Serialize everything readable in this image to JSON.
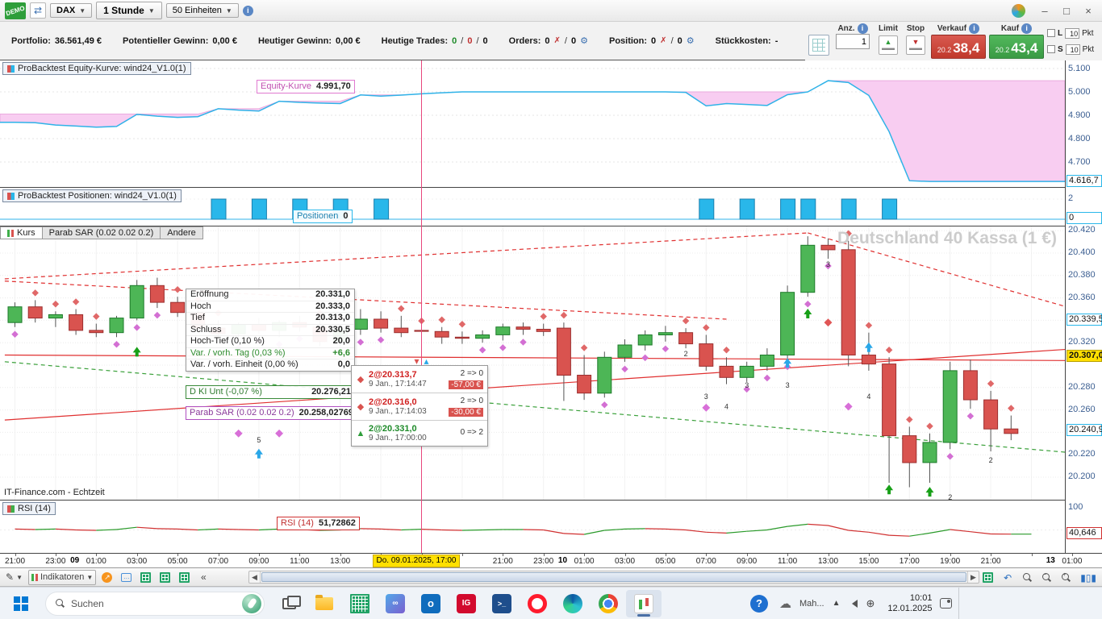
{
  "window": {
    "demo_badge": "DEMO",
    "instrument": "DAX",
    "timeframe": "1 Stunde",
    "units": "50 Einheiten"
  },
  "order_panel": {
    "anz_label": "Anz.",
    "anz_value": "1",
    "limit_label": "Limit",
    "stop_label": "Stop",
    "sell_label": "Verkauf",
    "sell_price_prefix": "20.2",
    "sell_price": "38,4",
    "buy_label": "Kauf",
    "buy_price_prefix": "20.2",
    "buy_price": "43,4",
    "long_label": "L",
    "short_label": "S",
    "long_pkt_value": "10",
    "short_pkt_value": "10",
    "pkt_label": "Pkt"
  },
  "stats": [
    {
      "label": "Portfolio:",
      "value": "36.561,49 €"
    },
    {
      "label": "Potentieller Gewinn:",
      "value": "0,00 €"
    },
    {
      "label": "Heutiger Gewinn:",
      "value": "0,00 €"
    },
    {
      "label": "Heutige Trades:",
      "v1": "0",
      "v2": "0",
      "v3": "0"
    },
    {
      "label": "Orders:",
      "v1": "0",
      "v2": "0"
    },
    {
      "label": "Position:",
      "v1": "0",
      "v2": "0"
    },
    {
      "label": "Stückkosten:",
      "value": "-"
    }
  ],
  "panels": {
    "equity_title": "ProBacktest Equity-Kurve: wind24_V1.0(1)",
    "equity_label": "Equity-Kurve",
    "equity_value": "4.991,70",
    "positions_title": "ProBacktest Positionen: wind24_V1.0(1)",
    "positions_label": "Positionen",
    "positions_value": "0",
    "rsi_title": "RSI (14)",
    "rsi_label": "RSI (14)",
    "rsi_value": "51,72862"
  },
  "main_chart": {
    "tabs": [
      "Kurs",
      "Parab SAR (0.02 0.02 0.2)",
      "Andere"
    ],
    "watermark": "Deutschland 40 Kassa (1 €)",
    "footer": "IT-Finance.com - Echtzeit",
    "tooltip": {
      "rows": [
        {
          "label": "Eröffnung",
          "value": "20.331,0"
        },
        {
          "label": "Hoch",
          "value": "20.333,0"
        },
        {
          "label": "Tief",
          "value": "20.313,0"
        },
        {
          "label": "Schluss",
          "value": "20.330,5"
        },
        {
          "label": "Hoch-Tief (0,10 %)",
          "value": "20,0"
        },
        {
          "label": "Var. / vorh. Tag (0,03 %)",
          "value": "+6,6"
        },
        {
          "label": "Var. / vorh. Einheit (0,00 %)",
          "value": "0,0"
        }
      ]
    },
    "dki": {
      "label": "D KI Unt (-0,07 %)",
      "value": "20.276,21"
    },
    "sar": {
      "label": "Parab SAR (0.02 0.02 0.2)",
      "value": "20.258,02769"
    },
    "trades": [
      {
        "qty": "2@20.313,7",
        "time": "9 Jan., 17:14:47",
        "transition": "2 => 0",
        "pnl": "-57,00 €"
      },
      {
        "qty": "2@20.316,0",
        "time": "9 Jan., 17:14:03",
        "transition": "2 => 0",
        "pnl": "-30,00 €"
      },
      {
        "qty": "2@20.331,0",
        "time": "9 Jan., 17:00:00",
        "transition": "0 => 2",
        "pnl": ""
      }
    ]
  },
  "axes": {
    "equity_ticks": [
      {
        "v": 5100,
        "label": "5.100"
      },
      {
        "v": 5000,
        "label": "5.000"
      },
      {
        "v": 4900,
        "label": "4.900"
      },
      {
        "v": 4800,
        "label": "4.800"
      },
      {
        "v": 4700,
        "label": "4.700"
      }
    ],
    "equity_current": {
      "v": 4616.7,
      "label": "4.616,7"
    },
    "positions_ticks": [
      {
        "level": 2,
        "label": "2"
      },
      {
        "level": 0,
        "label": "0"
      }
    ],
    "positions_current": {
      "label": "0"
    },
    "price_ticks": [
      {
        "v": 20420,
        "label": "20.420"
      },
      {
        "v": 20400,
        "label": "20.400"
      },
      {
        "v": 20380,
        "label": "20.380"
      },
      {
        "v": 20360,
        "label": "20.360"
      },
      {
        "v": 20320,
        "label": "20.320"
      },
      {
        "v": 20280,
        "label": "20.280"
      },
      {
        "v": 20260,
        "label": "20.260"
      },
      {
        "v": 20220,
        "label": "20.220"
      },
      {
        "v": 20200,
        "label": "20.200"
      }
    ],
    "price_current": [
      {
        "v": 20339.5,
        "label": "20.339,5",
        "style": "cyan"
      },
      {
        "v": 20307,
        "label": "20.307,0",
        "style": "yellow"
      },
      {
        "v": 20240.9,
        "label": "20.240,9",
        "style": "cyan"
      }
    ],
    "rsi_ticks": [
      {
        "v": 100,
        "label": "100"
      }
    ],
    "rsi_current": {
      "v": 40.646,
      "label": "40,646"
    }
  },
  "time_axis": {
    "hours": [
      {
        "i": 0,
        "t": "21:00"
      },
      {
        "i": 2,
        "t": "23:00"
      },
      {
        "i": 4,
        "t": "01:00"
      },
      {
        "i": 6,
        "t": "03:00"
      },
      {
        "i": 8,
        "t": "05:00"
      },
      {
        "i": 10,
        "t": "07:00"
      },
      {
        "i": 12,
        "t": "09:00"
      },
      {
        "i": 14,
        "t": "11:00"
      },
      {
        "i": 16,
        "t": "13:00"
      },
      {
        "i": 24,
        "t": "21:00"
      },
      {
        "i": 26,
        "t": "23:00"
      },
      {
        "i": 28,
        "t": "01:00"
      },
      {
        "i": 30,
        "t": "03:00"
      },
      {
        "i": 32,
        "t": "05:00"
      },
      {
        "i": 34,
        "t": "07:00"
      },
      {
        "i": 36,
        "t": "09:00"
      },
      {
        "i": 38,
        "t": "11:00"
      },
      {
        "i": 40,
        "t": "13:00"
      },
      {
        "i": 42,
        "t": "15:00"
      },
      {
        "i": 44,
        "t": "17:00"
      },
      {
        "i": 46,
        "t": "19:00"
      },
      {
        "i": 48,
        "t": "21:00"
      },
      {
        "i": 52,
        "t": "01:00"
      }
    ],
    "days": [
      {
        "i": 3,
        "t": "09"
      },
      {
        "i": 27,
        "t": "10"
      },
      {
        "i": 51,
        "t": "13"
      }
    ],
    "cursor": {
      "i": 20,
      "t": "Do. 09.01.2025, 17:00"
    }
  },
  "toolbar": {
    "indicators_label": "Indikatoren"
  },
  "taskbar": {
    "search_placeholder": "Suchen",
    "ig_label": "IG",
    "onedrive_text": "Mah...",
    "time": "10:01",
    "date": "12.01.2025"
  },
  "chart_data": {
    "type": "candlestick",
    "instrument": "DAX",
    "timeframe": "1 Stunde",
    "price_range": [
      20180,
      20424
    ],
    "candles": [
      [
        20338,
        20356,
        20334,
        20352
      ],
      [
        20352,
        20358,
        20338,
        20342
      ],
      [
        20342,
        20348,
        20334,
        20345
      ],
      [
        20345,
        20350,
        20327,
        20331
      ],
      [
        20331,
        20337,
        20325,
        20329
      ],
      [
        20329,
        20344,
        20325,
        20342
      ],
      [
        20342,
        20376,
        20340,
        20371
      ],
      [
        20371,
        20378,
        20351,
        20356
      ],
      [
        20356,
        20361,
        20343,
        20347
      ],
      [
        20347,
        20352,
        20329,
        20333
      ],
      [
        20333,
        20340,
        20323,
        20328
      ],
      [
        20328,
        20338,
        20322,
        20336
      ],
      [
        20336,
        20342,
        20328,
        20331
      ],
      [
        20331,
        20340,
        20325,
        20338
      ],
      [
        20338,
        20344,
        20330,
        20334
      ],
      [
        20334,
        20340,
        20317,
        20321
      ],
      [
        20321,
        20336,
        20315,
        20332
      ],
      [
        20332,
        20350,
        20327,
        20341
      ],
      [
        20341,
        20348,
        20329,
        20333
      ],
      [
        20333,
        20344,
        20325,
        20329
      ],
      [
        20331,
        20333,
        20313,
        20330.5
      ],
      [
        20330,
        20334,
        20319,
        20325
      ],
      [
        20325,
        20330,
        20319,
        20324
      ],
      [
        20324,
        20331,
        20320,
        20327
      ],
      [
        20327,
        20337,
        20322,
        20334
      ],
      [
        20334,
        20338,
        20327,
        20332
      ],
      [
        20332,
        20337,
        20326,
        20330
      ],
      [
        20333,
        20338,
        20268,
        20291
      ],
      [
        20291,
        20309,
        20269,
        20275
      ],
      [
        20275,
        20312,
        20271,
        20307
      ],
      [
        20307,
        20323,
        20303,
        20318
      ],
      [
        20318,
        20331,
        20313,
        20327
      ],
      [
        20327,
        20335,
        20321,
        20329
      ],
      [
        20329,
        20333,
        20315,
        20319
      ],
      [
        20319,
        20327,
        20295,
        20299
      ],
      [
        20299,
        20307,
        20283,
        20289
      ],
      [
        20289,
        20303,
        20285,
        20299
      ],
      [
        20299,
        20315,
        20295,
        20309
      ],
      [
        20309,
        20371,
        20305,
        20365
      ],
      [
        20365,
        20415,
        20361,
        20407
      ],
      [
        20407,
        20413,
        20395,
        20403
      ],
      [
        20403,
        20411,
        20299,
        20309
      ],
      [
        20309,
        20329,
        20295,
        20301
      ],
      [
        20301,
        20307,
        20195,
        20237
      ],
      [
        20237,
        20245,
        20191,
        20213
      ],
      [
        20213,
        20239,
        20195,
        20231
      ],
      [
        20231,
        20303,
        20225,
        20295
      ],
      [
        20295,
        20305,
        20261,
        20269
      ],
      [
        20269,
        20277,
        20223,
        20243
      ],
      [
        20243,
        20255,
        20233,
        20239
      ]
    ],
    "cursor_index": 20,
    "equity": {
      "start_max": 4905,
      "current": 4991.7,
      "values": [
        4870,
        4868,
        4858,
        4854,
        4849,
        4852,
        4904,
        4896,
        4891,
        4894,
        4928,
        4922,
        4918,
        4960,
        4955,
        4952,
        4950,
        4987,
        4982,
        4986,
        4991.7,
        4996,
        5000,
        5000,
        5000,
        5000,
        5000,
        5000,
        5000,
        5000,
        5000,
        5000,
        5000,
        4998,
        4940,
        4950,
        4946,
        4942,
        4988,
        5000,
        5048,
        5040,
        4985,
        4830,
        4620,
        4616.7,
        4616.7,
        4616.7,
        4616.7,
        4616.7,
        4616.7
      ]
    },
    "positions": {
      "level": 2,
      "bar_indices": [
        10,
        12,
        14,
        16,
        18,
        34,
        36,
        38,
        39,
        41,
        43
      ]
    },
    "rsi": {
      "period": 14,
      "current": 51.72862,
      "values": [
        52,
        51,
        52,
        50,
        49,
        51,
        56,
        53,
        52,
        50,
        52,
        51,
        50,
        52,
        51,
        49,
        50,
        53,
        52,
        50,
        51.7,
        50,
        49,
        50,
        51,
        51,
        50,
        42,
        40,
        49,
        52,
        53,
        52,
        50,
        45,
        43,
        47,
        50,
        58,
        63,
        60,
        49,
        45,
        38,
        36,
        43,
        51,
        46,
        41,
        40.6,
        40.6
      ]
    },
    "trendlines": [
      {
        "i1": -0.5,
        "p1": 20377,
        "i2": 39,
        "p2": 20418,
        "dash": true,
        "color": "red"
      },
      {
        "i1": 39,
        "p1": 20418,
        "i2": 52.5,
        "p2": 20348,
        "dash": true,
        "color": "red"
      },
      {
        "i1": -0.5,
        "p1": 20375,
        "i2": 35,
        "p2": 20341,
        "dash": true,
        "color": "red"
      },
      {
        "i1": -0.5,
        "p1": 20251,
        "i2": 52.5,
        "p2": 20315,
        "dash": false,
        "color": "red"
      },
      {
        "i1": -0.5,
        "p1": 20309,
        "i2": 52.5,
        "p2": 20304,
        "dash": false,
        "color": "red"
      },
      {
        "i1": -0.5,
        "p1": 20303,
        "i2": 52.5,
        "p2": 20221,
        "dash": true,
        "color": "green"
      }
    ],
    "markers": [
      {
        "i": 6,
        "p": 20312,
        "type": "arrow-up",
        "color": "#18a018"
      },
      {
        "i": 11,
        "p": 20239,
        "type": "diamond",
        "color": "#d86fd8"
      },
      {
        "i": 13,
        "p": 20239,
        "type": "diamond",
        "color": "#d86fd8"
      },
      {
        "i": 12,
        "p": 20233,
        "type": "num",
        "text": "5"
      },
      {
        "i": 12,
        "p": 20221,
        "type": "arrow-up",
        "color": "#2aa7e8"
      },
      {
        "i": 20,
        "p": 20303,
        "type": "cursor-orders"
      },
      {
        "i": 33,
        "p": 20310,
        "type": "num",
        "text": "2"
      },
      {
        "i": 34,
        "p": 20272,
        "type": "num",
        "text": "3"
      },
      {
        "i": 34,
        "p": 20262,
        "type": "diamond",
        "color": "#d86fd8"
      },
      {
        "i": 35,
        "p": 20263,
        "type": "num",
        "text": "4"
      },
      {
        "i": 36,
        "p": 20282,
        "type": "num",
        "text": "3"
      },
      {
        "i": 38,
        "p": 20302,
        "type": "arrow-up",
        "color": "#2aa7e8"
      },
      {
        "i": 38,
        "p": 20282,
        "type": "num",
        "text": "3"
      },
      {
        "i": 39,
        "p": 20346,
        "type": "arrow-up",
        "color": "#18a018"
      },
      {
        "i": 40,
        "p": 20390,
        "type": "num",
        "text": "3"
      },
      {
        "i": 40,
        "p": 20338,
        "type": "diamond",
        "color": "#e05555"
      },
      {
        "i": 41,
        "p": 20263,
        "type": "diamond",
        "color": "#d86fd8"
      },
      {
        "i": 42,
        "p": 20316,
        "type": "arrow-up",
        "color": "#2aa7e8"
      },
      {
        "i": 42,
        "p": 20272,
        "type": "num",
        "text": "4"
      },
      {
        "i": 43,
        "p": 20189,
        "type": "arrow-up",
        "color": "#18a018"
      },
      {
        "i": 45,
        "p": 20187,
        "type": "arrow-up",
        "color": "#18a018"
      },
      {
        "i": 46,
        "p": 20182,
        "type": "num",
        "text": "2"
      },
      {
        "i": 48,
        "p": 20215,
        "type": "num",
        "text": "2"
      }
    ]
  }
}
